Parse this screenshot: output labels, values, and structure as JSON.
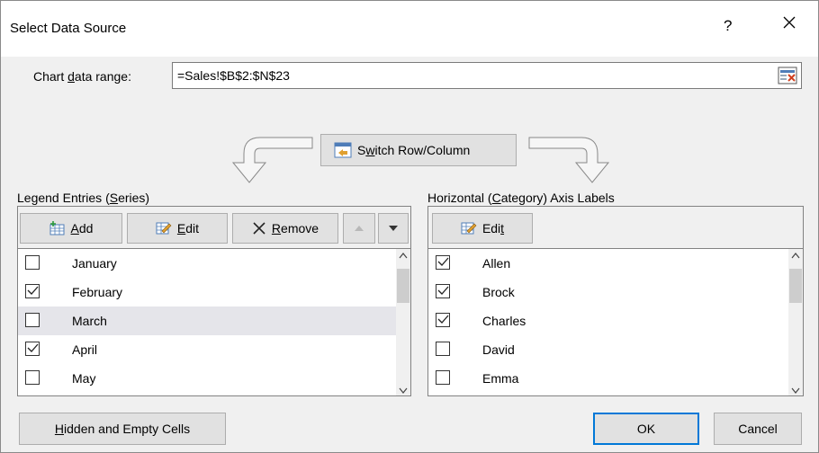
{
  "dialog": {
    "title": "Select Data Source",
    "help_label": "?",
    "close_label": "✕"
  },
  "range": {
    "label_pre": "Chart ",
    "label_accel": "d",
    "label_post": "ata range:",
    "value": "=Sales!$B$2:$N$23"
  },
  "switch": {
    "accel": "w",
    "pre": "S",
    "post": "itch Row/Column"
  },
  "legend": {
    "label_pre": "Legend Entries (",
    "label_accel": "S",
    "label_post": "eries)",
    "add": {
      "accel": "A",
      "post": "dd"
    },
    "edit": {
      "accel": "E",
      "post": "dit"
    },
    "remove": {
      "accel": "R",
      "post": "emove"
    },
    "items": [
      {
        "label": "January",
        "checked": false
      },
      {
        "label": "February",
        "checked": true
      },
      {
        "label": "March",
        "checked": false,
        "selected": true
      },
      {
        "label": "April",
        "checked": true
      },
      {
        "label": "May",
        "checked": false
      }
    ]
  },
  "axis": {
    "label_pre": "Horizontal (",
    "label_accel": "C",
    "label_post": "ategory) Axis Labels",
    "edit": {
      "pre": "Edi",
      "accel": "t"
    },
    "items": [
      {
        "label": "Allen",
        "checked": true
      },
      {
        "label": "Brock",
        "checked": true
      },
      {
        "label": "Charles",
        "checked": true
      },
      {
        "label": "David",
        "checked": false
      },
      {
        "label": "Emma",
        "checked": false
      }
    ]
  },
  "footer": {
    "hidden_accel": "H",
    "hidden_post": "idden and Empty Cells",
    "ok": "OK",
    "cancel": "Cancel"
  },
  "colors": {
    "accent": "#0078d7",
    "selected_row": "#e5e5ea"
  }
}
